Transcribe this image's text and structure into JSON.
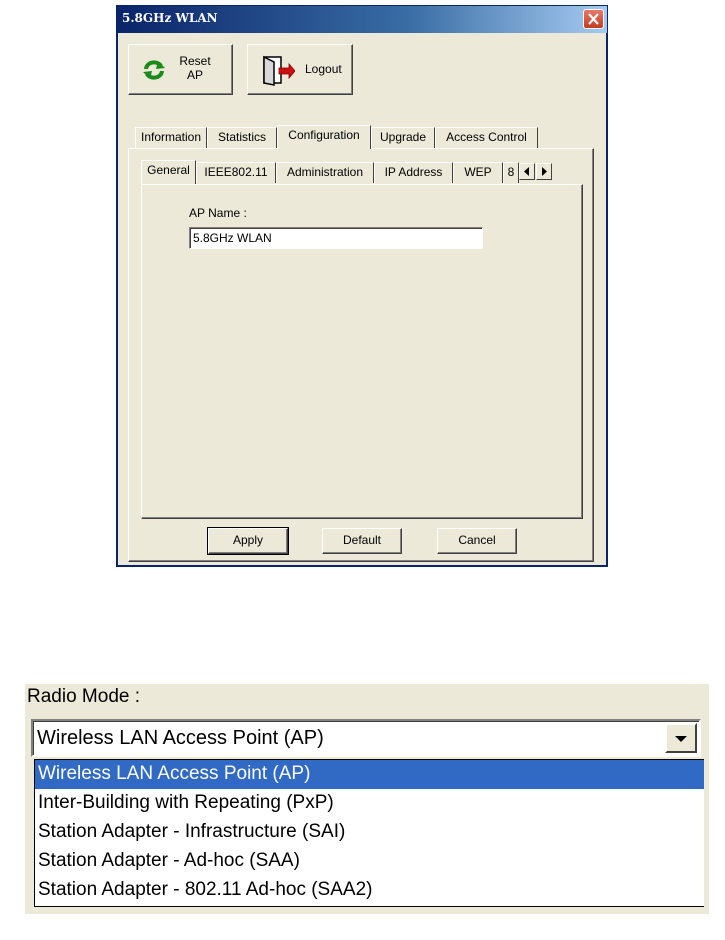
{
  "window": {
    "title": "5.8GHz WLAN",
    "toolbar": {
      "reset_label": "Reset AP",
      "reset_line1": "Reset",
      "reset_line2": "AP",
      "logout_label": "Logout"
    }
  },
  "main_tabs": [
    "Information",
    "Statistics",
    "Configuration",
    "Upgrade",
    "Access Control"
  ],
  "main_tabs_active": "Configuration",
  "sub_tabs": [
    "General",
    "IEEE802.11",
    "Administration",
    "IP Address",
    "WEP",
    "8"
  ],
  "sub_tabs_active": "General",
  "general": {
    "ap_name_label": "AP Name :",
    "ap_name_value": "5.8GHz WLAN"
  },
  "buttons": {
    "apply": "Apply",
    "default": "Default",
    "cancel": "Cancel"
  },
  "radio_mode": {
    "label": "Radio Mode :",
    "selected": "Wireless LAN Access Point (AP)",
    "options": [
      "Wireless LAN Access Point (AP)",
      "Inter-Building with Repeating (PxP)",
      "Station Adapter - Infrastructure (SAI)",
      "Station Adapter - Ad-hoc (SAA)",
      "Station Adapter - 802.11 Ad-hoc (SAA2)"
    ],
    "highlighted_index": 0
  },
  "colors": {
    "title_bar": "#0a246a",
    "dialog_bg": "#ece9d8",
    "selection": "#316ac5",
    "close_button": "#c63a20"
  }
}
